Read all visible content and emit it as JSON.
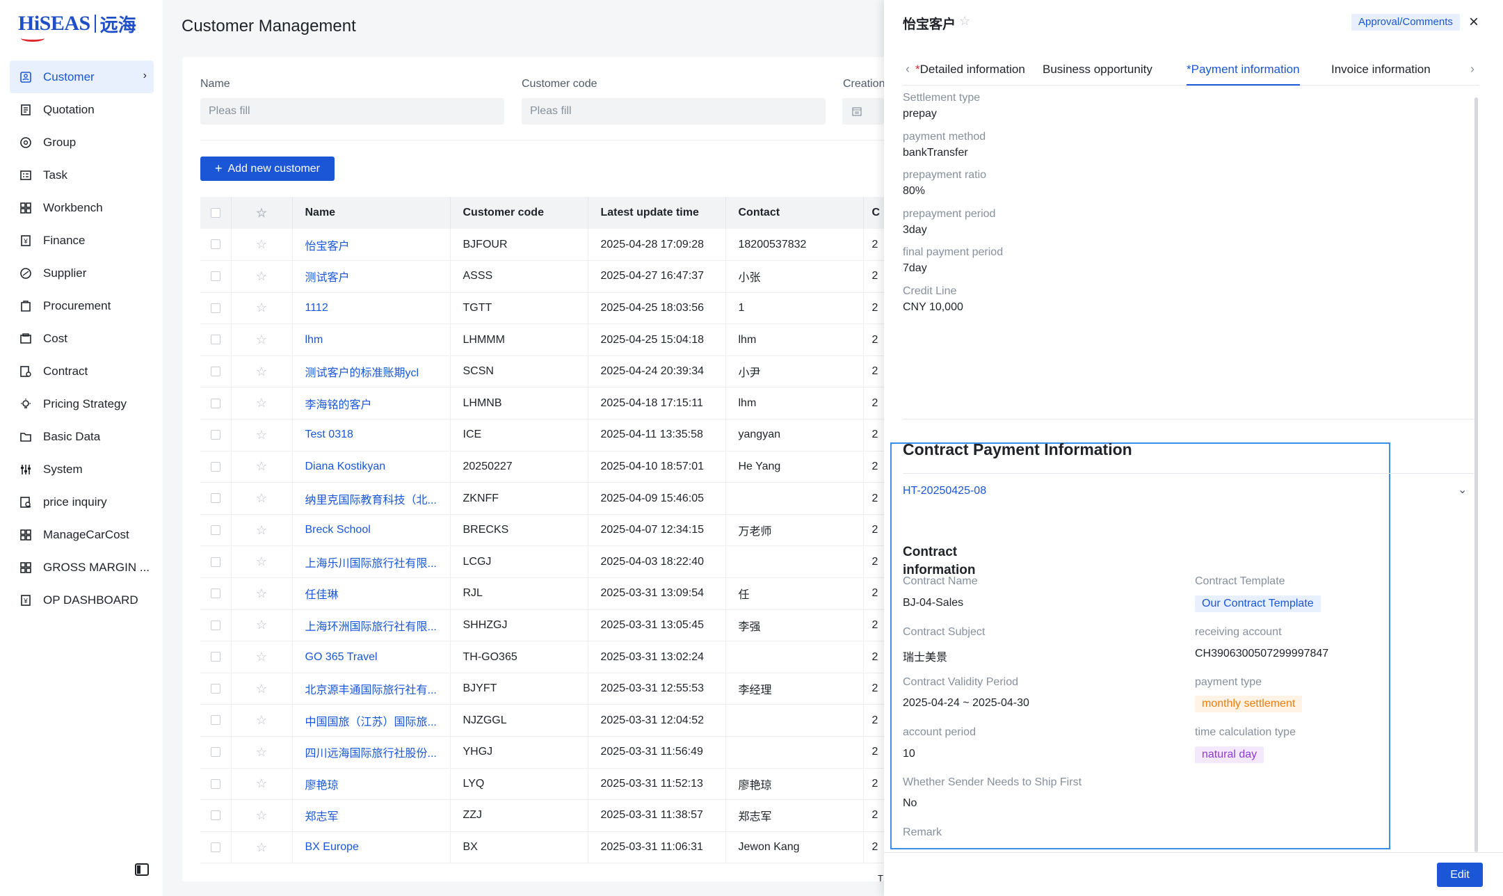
{
  "logo": {
    "en": "HiSEAS",
    "cn": "远海"
  },
  "sidebar": {
    "items": [
      {
        "label": "Customer",
        "icon": "customer-icon",
        "active": true
      },
      {
        "label": "Quotation",
        "icon": "quotation-icon"
      },
      {
        "label": "Group",
        "icon": "group-icon"
      },
      {
        "label": "Task",
        "icon": "task-icon"
      },
      {
        "label": "Workbench",
        "icon": "workbench-icon"
      },
      {
        "label": "Finance",
        "icon": "finance-icon"
      },
      {
        "label": "Supplier",
        "icon": "supplier-icon"
      },
      {
        "label": "Procurement",
        "icon": "procurement-icon"
      },
      {
        "label": "Cost",
        "icon": "cost-icon"
      },
      {
        "label": "Contract",
        "icon": "contract-icon"
      },
      {
        "label": "Pricing Strategy",
        "icon": "bulb-icon"
      },
      {
        "label": "Basic Data",
        "icon": "folder-icon"
      },
      {
        "label": "System",
        "icon": "sliders-icon"
      },
      {
        "label": "price inquiry",
        "icon": "inquiry-icon"
      },
      {
        "label": "ManageCarCost",
        "icon": "grid-icon"
      },
      {
        "label": "GROSS MARGIN ...",
        "icon": "grid-icon"
      },
      {
        "label": "OP DASHBOARD",
        "icon": "dashboard-icon"
      }
    ]
  },
  "main": {
    "title": "Customer Management",
    "filters": {
      "name_label": "Name",
      "name_placeholder": "Pleas fill",
      "code_label": "Customer code",
      "code_placeholder": "Pleas fill",
      "creation_label": "Creation"
    },
    "add_button": "Add new customer",
    "columns": [
      "Name",
      "Customer code",
      "Latest update time",
      "Contact",
      "C"
    ],
    "rows": [
      {
        "name": "怡宝客户",
        "code": "BJFOUR",
        "time": "2025-04-28 17:09:28",
        "contact": "18200537832",
        "cut": "2"
      },
      {
        "name": "测试客户",
        "code": "ASSS",
        "time": "2025-04-27 16:47:37",
        "contact": "小张",
        "cut": "2"
      },
      {
        "name": "1112",
        "code": "TGTT",
        "time": "2025-04-25 18:03:56",
        "contact": "1",
        "cut": "2"
      },
      {
        "name": "lhm",
        "code": "LHMMM",
        "time": "2025-04-25 15:04:18",
        "contact": "lhm",
        "cut": "2"
      },
      {
        "name": "测试客户的标准账期ycl",
        "code": "SCSN",
        "time": "2025-04-24 20:39:34",
        "contact": "小尹",
        "cut": "2"
      },
      {
        "name": "李海铭的客户",
        "code": "LHMNB",
        "time": "2025-04-18 17:15:11",
        "contact": "lhm",
        "cut": "2"
      },
      {
        "name": "Test 0318",
        "code": "ICE",
        "time": "2025-04-11 13:35:58",
        "contact": "yangyan",
        "cut": "2"
      },
      {
        "name": "Diana Kostikyan",
        "code": "20250227",
        "time": "2025-04-10 18:57:01",
        "contact": "He Yang",
        "cut": "2"
      },
      {
        "name": "纳里克国际教育科技（北...",
        "code": "ZKNFF",
        "time": "2025-04-09 15:46:05",
        "contact": "",
        "cut": "2"
      },
      {
        "name": "Breck School",
        "code": "BRECKS",
        "time": "2025-04-07 12:34:15",
        "contact": "万老师",
        "cut": "2"
      },
      {
        "name": "上海乐川国际旅行社有限...",
        "code": "LCGJ",
        "time": "2025-04-03 18:22:40",
        "contact": "",
        "cut": "2"
      },
      {
        "name": "任佳琳",
        "code": "RJL",
        "time": "2025-03-31 13:09:54",
        "contact": "任",
        "cut": "2"
      },
      {
        "name": "上海环洲国际旅行社有限...",
        "code": "SHHZGJ",
        "time": "2025-03-31 13:05:45",
        "contact": "李强",
        "cut": "2"
      },
      {
        "name": "GO 365 Travel",
        "code": "TH-GO365",
        "time": "2025-03-31 13:02:24",
        "contact": "",
        "cut": "2"
      },
      {
        "name": "北京源丰通国际旅行社有...",
        "code": "BJYFT",
        "time": "2025-03-31 12:55:53",
        "contact": "李经理",
        "cut": "2"
      },
      {
        "name": "中国国旅（江苏）国际旅...",
        "code": "NJZGGL",
        "time": "2025-03-31 12:04:52",
        "contact": "",
        "cut": "2"
      },
      {
        "name": "四川远海国际旅行社股份...",
        "code": "YHGJ",
        "time": "2025-03-31 11:56:49",
        "contact": "",
        "cut": "2"
      },
      {
        "name": "廖艳琼",
        "code": "LYQ",
        "time": "2025-03-31 11:52:13",
        "contact": "廖艳琼",
        "cut": "2"
      },
      {
        "name": "郑志军",
        "code": "ZZJ",
        "time": "2025-03-31 11:38:57",
        "contact": "郑志军",
        "cut": "2"
      },
      {
        "name": "BX Europe",
        "code": "BX",
        "time": "2025-03-31 11:06:31",
        "contact": "Jewon Kang",
        "cut": "2"
      }
    ],
    "footer_cut": "T"
  },
  "drawer": {
    "title": "怡宝客户",
    "approval": "Approval/Comments",
    "tabs": [
      "Detailed information",
      "Business opportunity",
      "Payment information",
      "Invoice information"
    ],
    "payment": [
      {
        "label": "Settlement type",
        "value": "prepay"
      },
      {
        "label": "payment method",
        "value": "bankTransfer"
      },
      {
        "label": "prepayment ratio",
        "value": "80%"
      },
      {
        "label": "prepayment period",
        "value": "3day"
      },
      {
        "label": "final payment period",
        "value": "7day"
      },
      {
        "label": "Credit Line",
        "value": "CNY 10,000"
      }
    ],
    "contract_section": {
      "title": "Contract Payment Information",
      "contract_no": "HT-20250425-08",
      "info_title": "Contract information",
      "contract_name_label": "Contract Name",
      "contract_name": "BJ-04-Sales",
      "template_label": "Contract Template",
      "template": "Our Contract Template",
      "subject_label": "Contract Subject",
      "subject": "瑞士美景",
      "account_label": "receiving account",
      "account": "CH3906300507299997847",
      "validity_label": "Contract Validity Period",
      "validity": "2025-04-24 ~ 2025-04-30",
      "payment_type_label": "payment type",
      "payment_type": "monthly settlement",
      "account_period_label": "account period",
      "account_period": "10",
      "time_calc_label": "time calculation type",
      "time_calc": "natural day",
      "ship_first_label": "Whether Sender Needs to Ship First",
      "ship_first": "No",
      "remark_label": "Remark"
    },
    "edit_button": "Edit"
  },
  "colors": {
    "accent": "#1a56d6",
    "highlight_border": "#3a8eea",
    "orange": "#f07c0a",
    "purple": "#8e3ad6"
  }
}
